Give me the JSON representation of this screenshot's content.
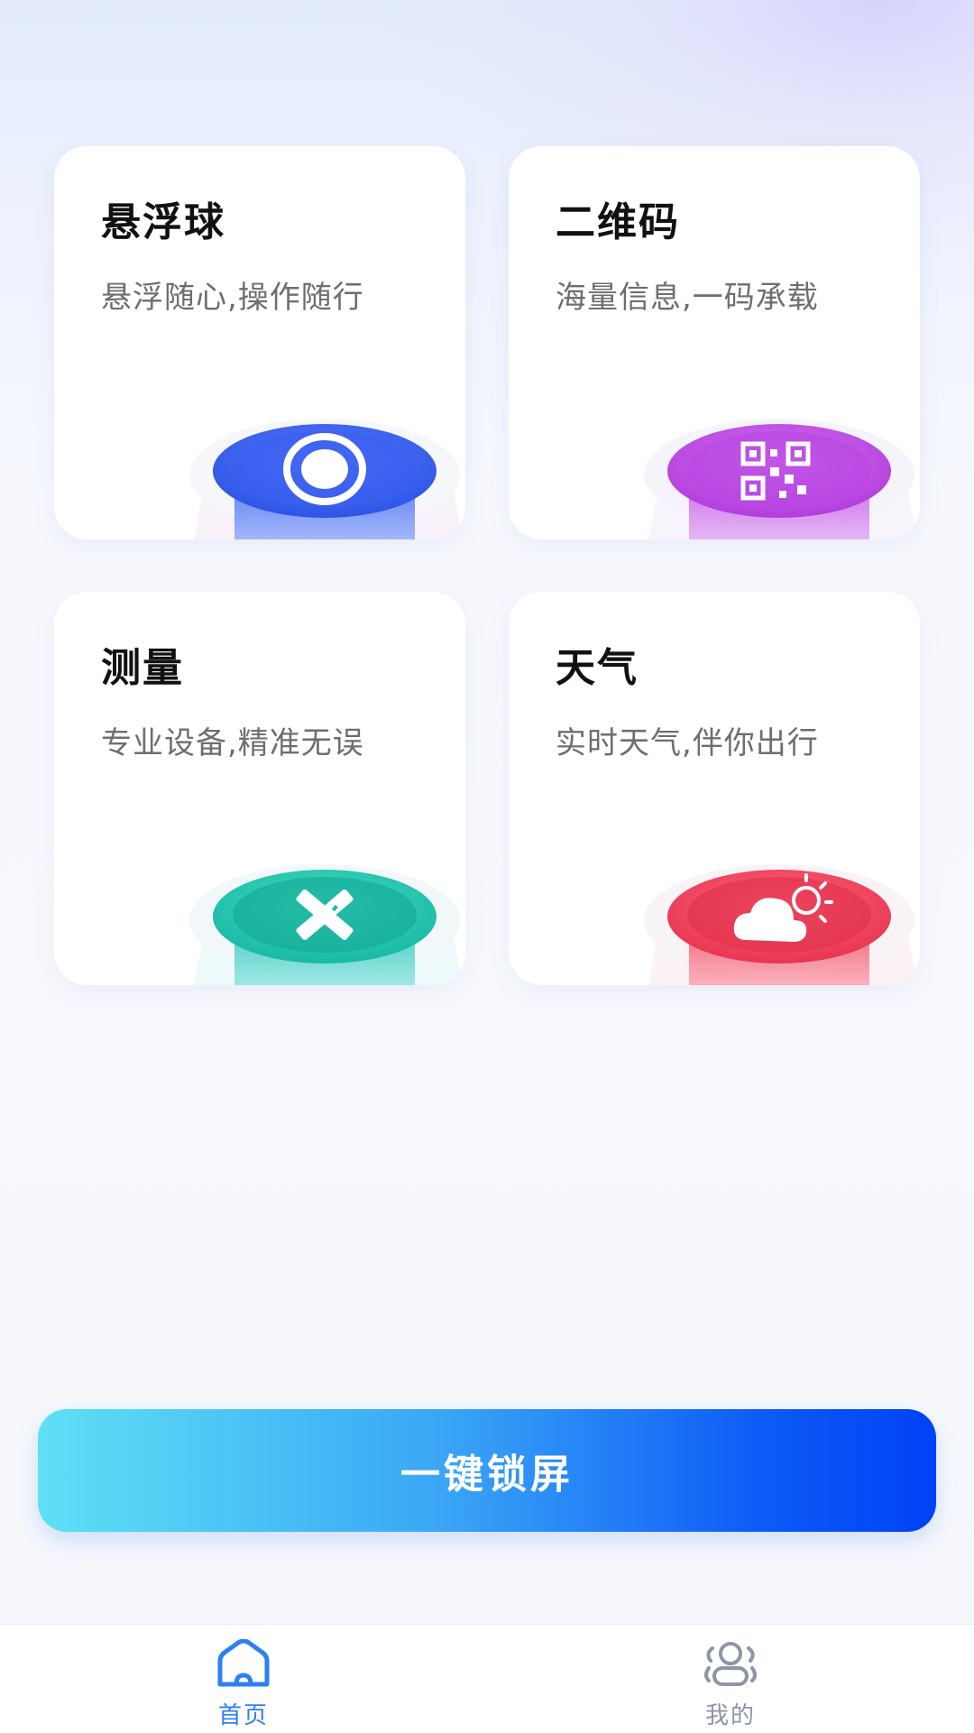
{
  "features": [
    {
      "title": "悬浮球",
      "subtitle": "悬浮随心,操作随行",
      "icon": "ring-icon",
      "color": "#3e63f0"
    },
    {
      "title": "二维码",
      "subtitle": "海量信息,一码承载",
      "icon": "qr-code-icon",
      "color": "#c24fe6"
    },
    {
      "title": "测量",
      "subtitle": "专业设备,精准无误",
      "icon": "ruler-pencil-icon",
      "color": "#20c3b0"
    },
    {
      "title": "天气",
      "subtitle": "实时天气,伴你出行",
      "icon": "cloud-sun-icon",
      "color": "#f2485f"
    }
  ],
  "lock_button": {
    "label": "一键锁屏"
  },
  "tabbar": {
    "tabs": [
      {
        "label": "首页",
        "icon": "home-icon",
        "active": true,
        "color": "#2d7ff2"
      },
      {
        "label": "我的",
        "icon": "profile-icon",
        "active": false,
        "color": "#8d95a8"
      }
    ]
  }
}
